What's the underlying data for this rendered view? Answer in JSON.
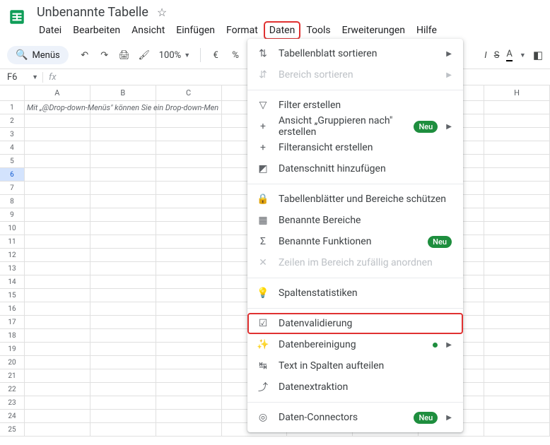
{
  "doc": {
    "title": "Unbenannte Tabelle"
  },
  "menubar": [
    "Datei",
    "Bearbeiten",
    "Ansicht",
    "Einfügen",
    "Format",
    "Daten",
    "Tools",
    "Erweiterungen",
    "Hilfe"
  ],
  "menubar_highlight_index": 5,
  "search": {
    "label": "Menüs"
  },
  "toolbar": {
    "zoom": "100%",
    "currency": "€",
    "percent": "%"
  },
  "namebox": {
    "value": "F6",
    "fx": "fx"
  },
  "columns": [
    "A",
    "B",
    "C",
    "",
    "",
    "",
    "",
    "H"
  ],
  "row_count": 25,
  "selected_row": 6,
  "hint_cell": {
    "row": 1,
    "text": "Mit „@Drop-down-Menüs\" können Sie ein Drop-down-Men"
  },
  "menu": {
    "items": [
      {
        "icon": "sort-sheet",
        "label": "Tabellenblatt sortieren",
        "arrow": true
      },
      {
        "icon": "sort-range",
        "label": "Bereich sortieren",
        "arrow": true,
        "disabled": true
      },
      {
        "sep": true
      },
      {
        "icon": "filter",
        "label": "Filter erstellen"
      },
      {
        "icon": "plus",
        "label": "Ansicht „Gruppieren nach\" erstellen",
        "badge": "Neu",
        "arrow": true
      },
      {
        "icon": "plus",
        "label": "Filteransicht erstellen"
      },
      {
        "icon": "slicer",
        "label": "Datenschnitt hinzufügen"
      },
      {
        "sep": true
      },
      {
        "icon": "lock",
        "label": "Tabellenblätter und Bereiche schützen"
      },
      {
        "icon": "named-range",
        "label": "Benannte Bereiche"
      },
      {
        "icon": "sigma",
        "label": "Benannte Funktionen",
        "badge": "Neu"
      },
      {
        "icon": "shuffle",
        "label": "Zeilen im Bereich zufällig anordnen",
        "disabled": true
      },
      {
        "sep": true
      },
      {
        "icon": "bulb",
        "label": "Spaltenstatistiken"
      },
      {
        "sep": true
      },
      {
        "icon": "validation",
        "label": "Datenvalidierung",
        "highlight": true
      },
      {
        "icon": "cleanup",
        "label": "Datenbereinigung",
        "dot": true,
        "arrow": true
      },
      {
        "icon": "split",
        "label": "Text in Spalten aufteilen"
      },
      {
        "icon": "extract",
        "label": "Datenextraktion"
      },
      {
        "sep": true
      },
      {
        "icon": "connector",
        "label": "Daten-Connectors",
        "badge": "Neu",
        "arrow": true
      }
    ]
  },
  "format_right": {
    "italic": "I",
    "strike": "S",
    "underline": "A"
  }
}
